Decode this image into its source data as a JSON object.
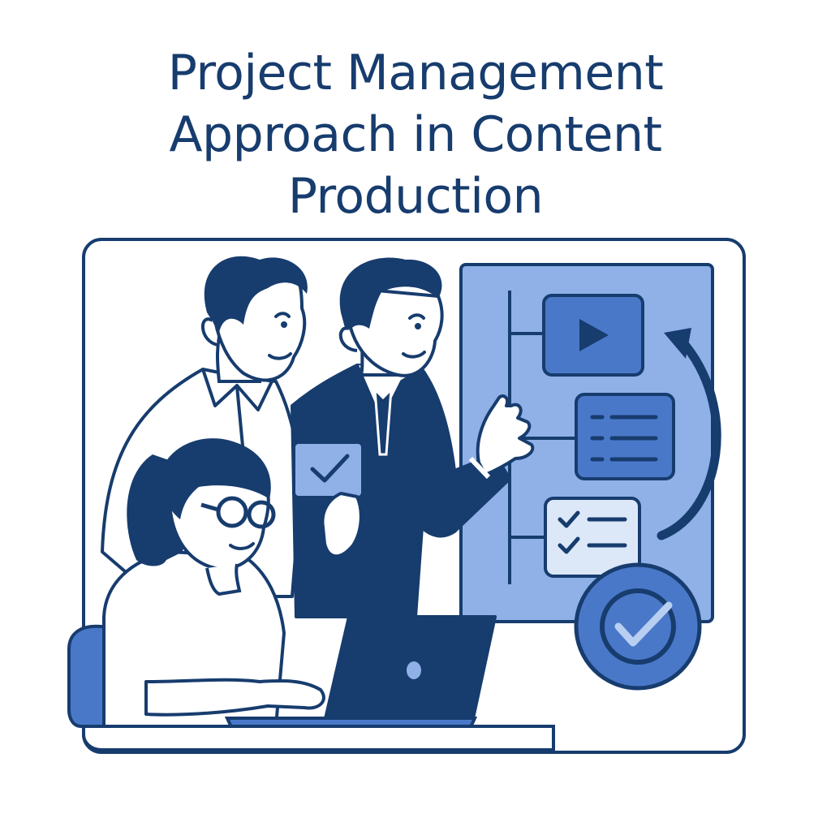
{
  "title": {
    "line1": "Project Management",
    "line2": "Approach in Content",
    "line3": "Production"
  },
  "colors": {
    "navy": "#173c6e",
    "accent_blue": "#4a78c9",
    "panel_blue": "#8fb1e8",
    "light_blue": "#b9cff1",
    "white": "#ffffff"
  },
  "icons": [
    "play-icon",
    "list-icon",
    "checklist-icon",
    "check-badge-icon",
    "refresh-arrow-icon",
    "laptop-icon",
    "check-card-icon"
  ]
}
